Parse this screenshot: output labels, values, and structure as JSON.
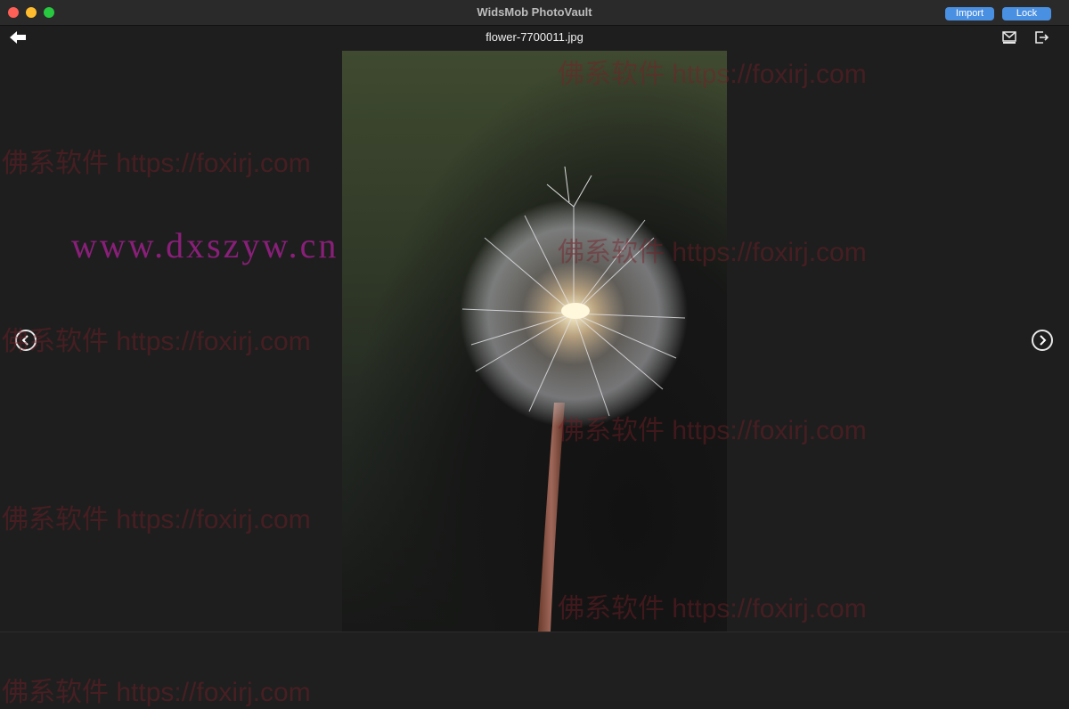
{
  "window": {
    "title": "WidsMob PhotoVault",
    "import_label": "Import",
    "lock_label": "Lock"
  },
  "toolbar": {
    "filename": "flower-7700011.jpg"
  },
  "icons": {
    "back": "back-arrow-icon",
    "mail": "mail-icon",
    "export": "export-icon",
    "prev": "chevron-left-icon",
    "next": "chevron-right-icon"
  },
  "watermarks": {
    "foxirj": "佛系软件 https://foxirj.com",
    "dxszyw": "www.dxszyw.cn"
  },
  "colors": {
    "accent": "#4a90e2",
    "background": "#1e1e1e"
  }
}
